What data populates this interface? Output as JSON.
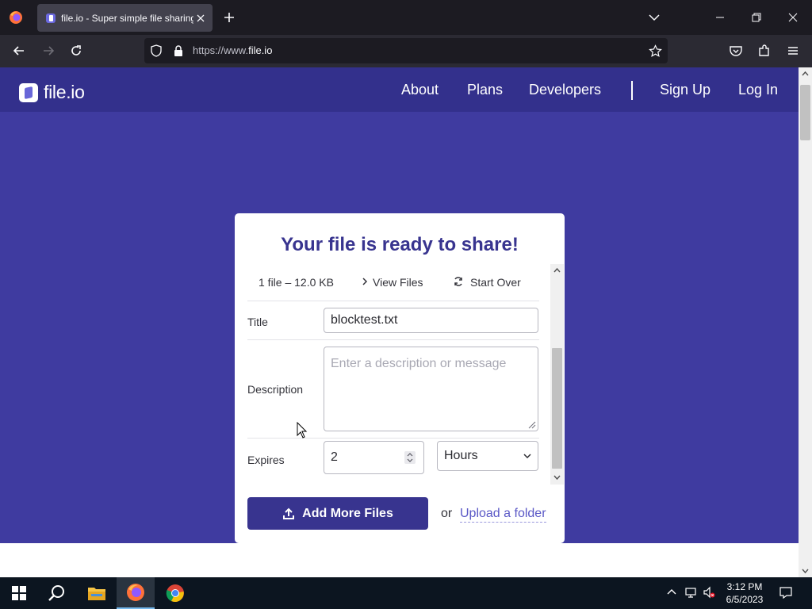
{
  "browser": {
    "tab_title": "file.io - Super simple file sharing",
    "url_prefix": "https://www.",
    "url_domain": "file.io"
  },
  "site": {
    "logo_text": "file.io",
    "nav": [
      "About",
      "Plans",
      "Developers",
      "Sign Up",
      "Log In"
    ]
  },
  "card": {
    "title": "Your file is ready to share!",
    "file_summary": "1 file – 12.0 KB",
    "view_files": "View Files",
    "start_over": "Start Over",
    "title_label": "Title",
    "title_value": "blocktest.txt",
    "description_label": "Description",
    "description_placeholder": "Enter a description or message",
    "expires_label": "Expires",
    "expires_value": "2",
    "expires_unit": "Hours",
    "add_files": "Add More Files",
    "or": "or",
    "upload_folder": "Upload a folder"
  },
  "taskbar": {
    "time": "3:12 PM",
    "date": "6/5/2023"
  },
  "colors": {
    "header": "#33308c",
    "hero": "#3f3ba0",
    "accent": "#38348f",
    "link": "#5a58c6"
  }
}
